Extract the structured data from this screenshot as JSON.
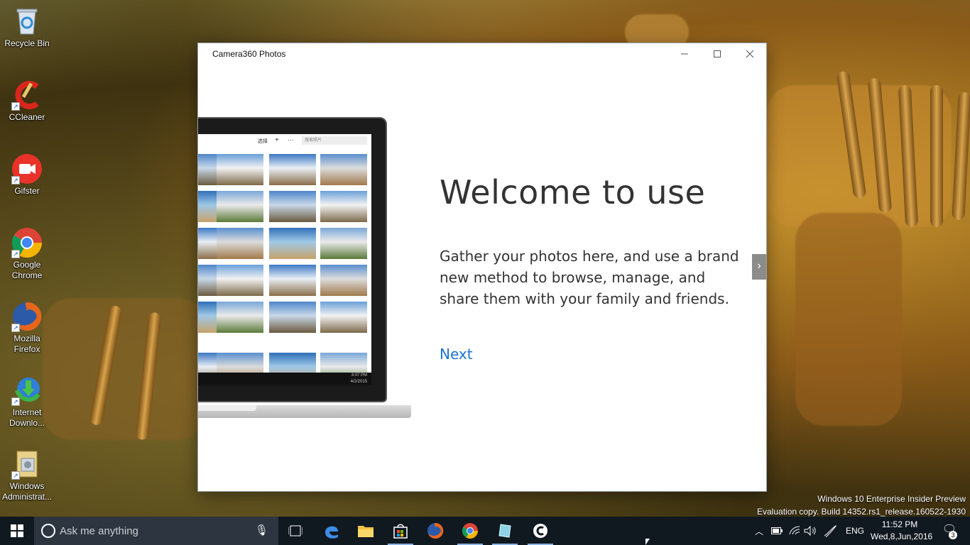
{
  "desktop": {
    "icons": [
      {
        "label": "Recycle Bin",
        "icon": "recycle-bin-icon"
      },
      {
        "label": "CCleaner",
        "icon": "ccleaner-icon"
      },
      {
        "label": "Gifster",
        "icon": "gifster-icon"
      },
      {
        "label": "Google Chrome",
        "icon": "chrome-icon"
      },
      {
        "label": "Mozilla Firefox",
        "icon": "firefox-icon"
      },
      {
        "label": "Internet Downlo...",
        "icon": "idm-icon"
      },
      {
        "label": "Windows Administrat...",
        "icon": "admin-tools-icon"
      }
    ],
    "watermark": {
      "line1": "Windows 10 Enterprise Insider Preview",
      "line2": "Evaluation copy. Build 14352.rs1_release.160522-1930"
    }
  },
  "window": {
    "title": "Camera360 Photos",
    "welcome_title": "Welcome to use",
    "welcome_desc": "Gather your photos here, and use a brand new method to browse, manage, and share them with your family and friends.",
    "next_label": "Next",
    "laptop_mock": {
      "toolbar_label": "选择",
      "add": "+",
      "more": "···",
      "search_placeholder": "搜索照片",
      "clock": "3:07 PM",
      "date": "4/2/2015"
    }
  },
  "taskbar": {
    "search_placeholder": "Ask me anything",
    "language": "ENG",
    "time": "11:52 PM",
    "date": "Wed,8,Jun,2016",
    "notification_count": "3"
  },
  "colors": {
    "accent": "#1a73d1",
    "taskbar": "#101820",
    "search_box": "#2d3640"
  }
}
